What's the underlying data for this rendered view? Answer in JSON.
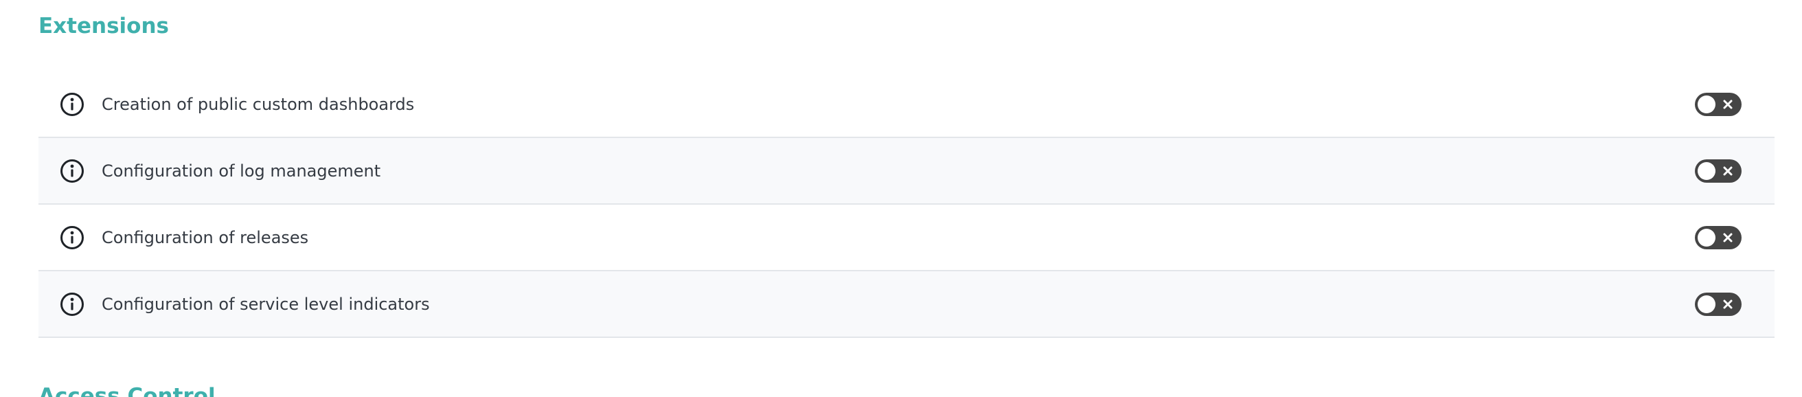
{
  "extensions": {
    "heading": "Extensions",
    "settings": [
      {
        "label": "Creation of public custom dashboards",
        "enabled": false
      },
      {
        "label": "Configuration of log management",
        "enabled": false
      },
      {
        "label": "Configuration of releases",
        "enabled": false
      },
      {
        "label": "Configuration of service level indicators",
        "enabled": false
      }
    ]
  },
  "access_control": {
    "heading": "Access Control"
  },
  "colors": {
    "heading": "#3fb0ac",
    "toggle_off": "#454545",
    "row_alt_bg": "#f8f9fb",
    "divider": "#e3e6ea"
  },
  "icons": {
    "row_info": "info-circle-icon",
    "toggle_off": "close-x-icon"
  }
}
